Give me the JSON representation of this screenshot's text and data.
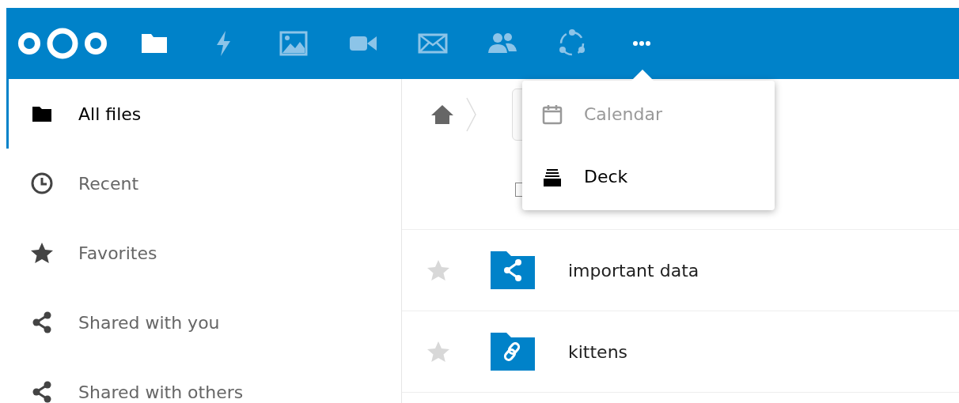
{
  "header": {
    "apps": [
      {
        "kind": "files",
        "active": true
      },
      {
        "kind": "activity",
        "active": false
      },
      {
        "kind": "photos",
        "active": false
      },
      {
        "kind": "video",
        "active": false
      },
      {
        "kind": "mail",
        "active": false
      },
      {
        "kind": "contacts",
        "active": false
      },
      {
        "kind": "circles",
        "active": false
      },
      {
        "kind": "more",
        "active": true
      }
    ]
  },
  "sidebar": {
    "items": [
      {
        "kind": "folder",
        "label": "All files",
        "selected": true
      },
      {
        "kind": "clock",
        "label": "Recent",
        "selected": false
      },
      {
        "kind": "star",
        "label": "Favorites",
        "selected": false
      },
      {
        "kind": "share",
        "label": "Shared with you",
        "selected": false
      },
      {
        "kind": "share",
        "label": "Shared with others",
        "selected": false
      }
    ]
  },
  "file_list": {
    "select_all": {
      "checked": false
    },
    "rows": [
      {
        "kind": "shared",
        "name": "important data",
        "favorite": false
      },
      {
        "kind": "link",
        "name": "kittens",
        "favorite": false
      }
    ]
  },
  "apps_menu": {
    "items": [
      {
        "kind": "calendar",
        "label": "Calendar",
        "active": false
      },
      {
        "kind": "deck",
        "label": "Deck",
        "active": true
      }
    ]
  }
}
